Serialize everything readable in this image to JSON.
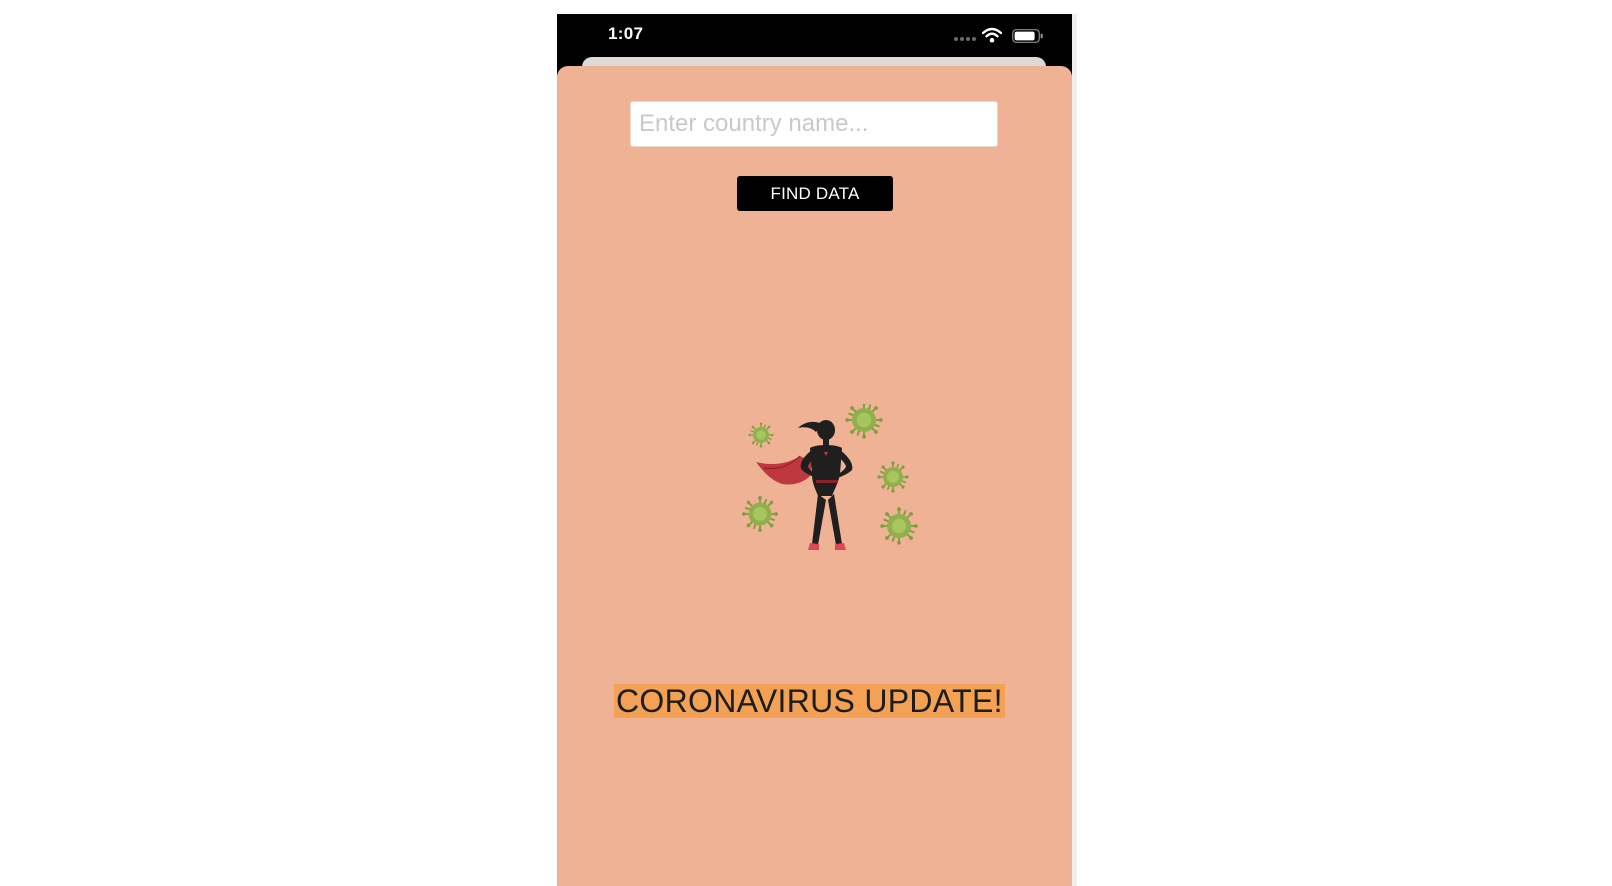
{
  "status_bar": {
    "time": "1:07"
  },
  "search": {
    "placeholder": "Enter country name...",
    "value": ""
  },
  "find_button": {
    "label": "FIND DATA"
  },
  "illustration": {
    "icon": "superhero-woman-with-virus-particles"
  },
  "headline": {
    "text": "CORONAVIRUS UPDATE!"
  },
  "colors": {
    "screen_background": "#efb295",
    "headline_highlight": "#f2a155",
    "button_background": "#000000",
    "virus_green": "#8fb04a",
    "cape_red": "#c0383f"
  }
}
